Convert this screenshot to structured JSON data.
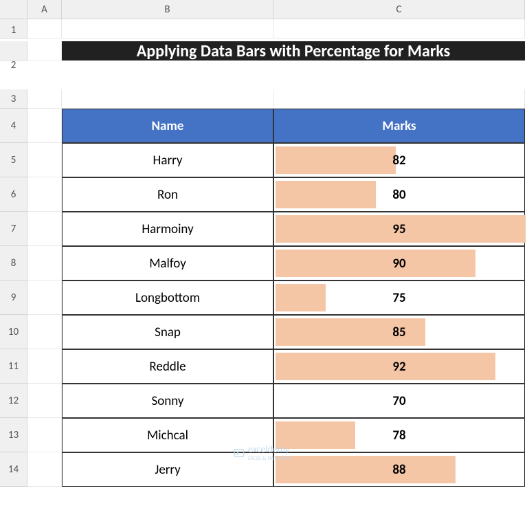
{
  "columns": [
    "A",
    "B",
    "C"
  ],
  "rows": [
    "1",
    "2",
    "3",
    "4",
    "5",
    "6",
    "7",
    "8",
    "9",
    "10",
    "11",
    "12",
    "13",
    "14"
  ],
  "title": "Applying Data Bars with Percentage for Marks",
  "headers": {
    "name": "Name",
    "marks": "Marks"
  },
  "names": [
    "Harry",
    "Ron",
    "Harmoiny",
    "Malfoy",
    "Longbottom",
    "Snap",
    "Reddle",
    "Sonny",
    "Michcal",
    "Jerry"
  ],
  "marks": [
    82,
    80,
    95,
    90,
    75,
    85,
    92,
    70,
    78,
    88
  ],
  "chart_data": {
    "type": "bar",
    "categories": [
      "Harry",
      "Ron",
      "Harmoiny",
      "Malfoy",
      "Longbottom",
      "Snap",
      "Reddle",
      "Sonny",
      "Michcal",
      "Jerry"
    ],
    "values": [
      82,
      80,
      95,
      90,
      75,
      85,
      92,
      70,
      78,
      88
    ],
    "title": "Applying Data Bars with Percentage for Marks",
    "xlabel": "Name",
    "ylabel": "Marks",
    "ylim": [
      70,
      95
    ],
    "bar_color": "#f4c6a6"
  },
  "watermark": {
    "brand": "exceldemy",
    "tagline": "EXCEL & DATA HUB"
  }
}
